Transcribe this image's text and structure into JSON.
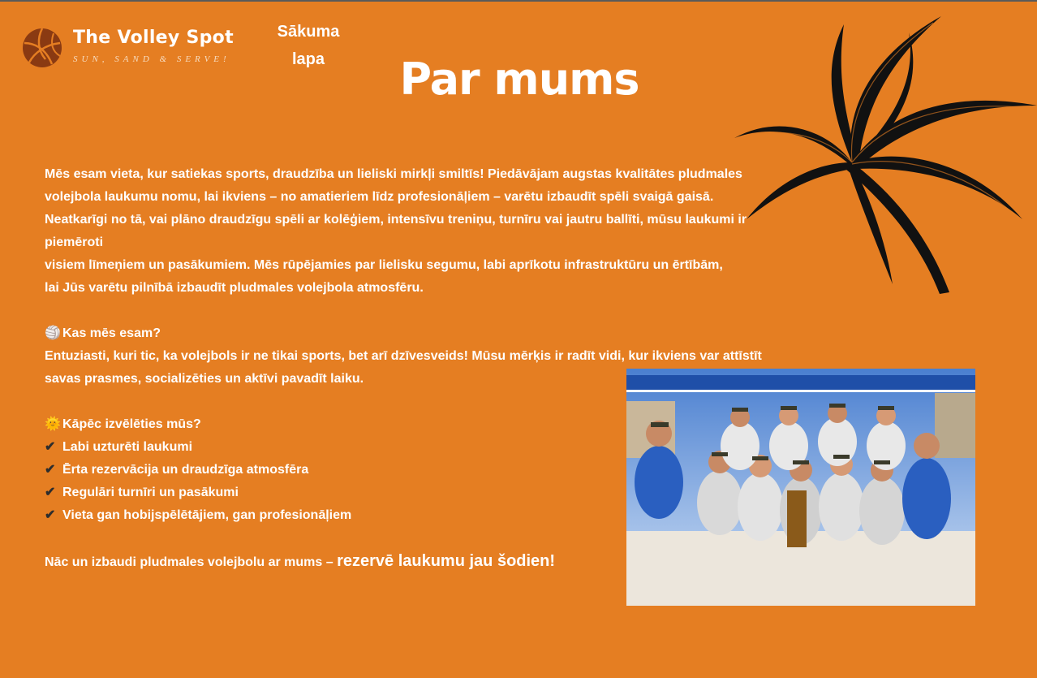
{
  "brand": {
    "name": "The Volley Spot",
    "tagline": "SUN, SAND & SERVE!"
  },
  "nav": {
    "home_label_1": "Sākuma",
    "home_label_2": "lapa"
  },
  "page": {
    "title": "Par mums"
  },
  "intro": {
    "line1": "Mēs esam vieta, kur satiekas sports, draudzība un lieliski mirkļi smiltīs! Piedāvājam augstas kvalitātes pludmales",
    "line2": "volejbola laukumu nomu, lai ikviens – no amatieriem līdz profesionāļiem – varētu izbaudīt spēli svaigā gaisā.",
    "line3": "Neatkarīgi no tā, vai plāno draudzīgu spēli ar kolēģiem, intensīvu treniņu, turnīru vai jautru ballīti, mūsu laukumi ir piemēroti",
    "line4": "visiem līmeņiem un pasākumiem. Mēs rūpējamies par lielisku segumu, labi aprīkotu infrastruktūru un ērtībām,",
    "line5": "lai Jūs varētu pilnībā izbaudīt pludmales volejbola atmosfēru."
  },
  "who": {
    "heading": "Kas mēs esam?",
    "line1": "Entuziasti, kuri tic, ka volejbols ir ne tikai sports, bet arī dzīvesveids! Mūsu mērķis ir radīt vidi, kur ikviens var attīstīt",
    "line2": "savas prasmes, socializēties un aktīvi pavadīt laiku."
  },
  "why": {
    "heading": "Kāpēc izvēlēties mūs?",
    "items": [
      "Labi uzturēti laukumi",
      "Ērta rezervācija un draudzīga atmosfēra",
      "Regulāri turnīri un pasākumi",
      "Vieta gan hobijspēlētājiem, gan profesionāļiem"
    ]
  },
  "cta": {
    "text": "Nāc un izbaudi pludmales volejbolu ar mums – ",
    "big": "rezervē laukumu jau šodien!"
  },
  "icons": {
    "volleyball": "volleyball-emoji",
    "sun": "sun-emoji",
    "check": "check-mark"
  },
  "colors": {
    "background": "#e57e22",
    "text": "#ffffff",
    "ball": "#8a3a12",
    "palm": "#111111"
  }
}
